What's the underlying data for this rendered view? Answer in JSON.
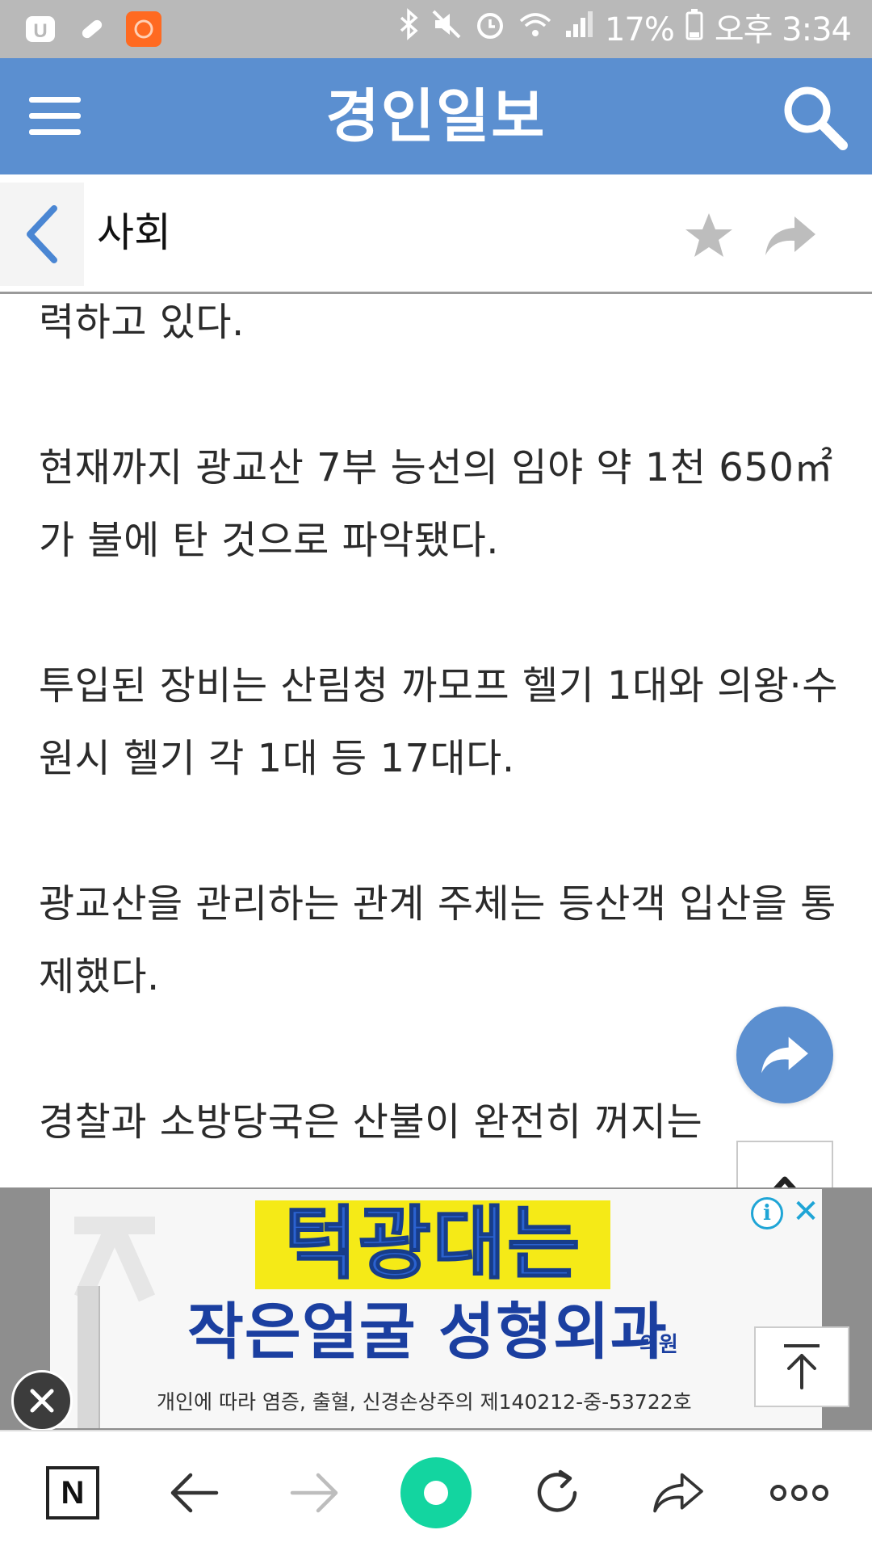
{
  "status_bar": {
    "battery_percent": "17%",
    "time": "오후 3:34",
    "icons": [
      "u-plus-icon",
      "bandage-icon",
      "app-orange-icon",
      "bluetooth-icon",
      "mute-icon",
      "alarm-icon",
      "wifi-icon",
      "signal-icon",
      "battery-icon"
    ]
  },
  "header": {
    "brand": "경인일보",
    "color": "#5b8fd0"
  },
  "section": {
    "title": "사회"
  },
  "article": {
    "paragraphs": [
      "력하고 있다.",
      "현재까지 광교산 7부 능선의 임야 약 1천 650㎡가 불에 탄 것으로 파악됐다.",
      "투입된 장비는 산림청 까모프 헬기 1대와 의왕·수원시 헬기 각 1대 등 17대다.",
      "광교산을 관리하는 관계 주체는 등산객 입산을 통제했다.",
      "경찰과 소방당국은 산불이 완전히 꺼지는"
    ]
  },
  "ad": {
    "headline": "턱광대는",
    "subline": "작은얼굴 성형외과",
    "subline_suffix": "의원",
    "fine_print": "개인에 따라 염증, 출혈, 신경손상주의 제140212-중-53722호",
    "info_label": "i",
    "x_label": "✕",
    "highlight_color": "#f5ea17"
  },
  "bottom_nav": {
    "home_label": "N",
    "accent_color": "#13d5a0"
  }
}
